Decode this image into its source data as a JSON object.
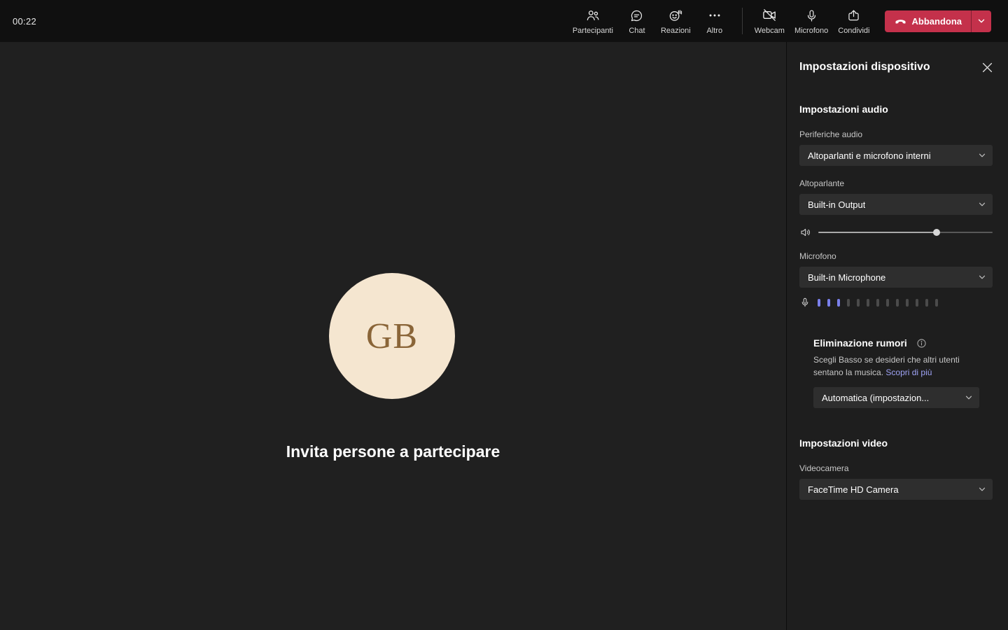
{
  "topbar": {
    "timer": "00:22",
    "buttons": {
      "participants": "Partecipanti",
      "chat": "Chat",
      "reactions": "Reazioni",
      "more": "Altro",
      "webcam": "Webcam",
      "microphone": "Microfono",
      "share": "Condividi",
      "leave": "Abbandona"
    }
  },
  "stage": {
    "avatar_initials": "GB",
    "invite_text": "Invita persone a partecipare"
  },
  "panel": {
    "title": "Impostazioni dispositivo",
    "audio": {
      "section_title": "Impostazioni audio",
      "devices_label": "Periferiche audio",
      "devices_value": "Altoparlanti e microfono interni",
      "speaker_label": "Altoparlante",
      "speaker_value": "Built-in Output",
      "volume_percent": 68,
      "mic_label": "Microfono",
      "mic_value": "Built-in Microphone",
      "mic_level_active": 3,
      "mic_level_total": 13
    },
    "noise": {
      "title": "Eliminazione rumori",
      "description": "Scegli Basso se desideri che altri utenti sentano la musica.",
      "link": "Scopri di più",
      "value": "Automatica (impostazion..."
    },
    "video": {
      "section_title": "Impostazioni video",
      "camera_label": "Videocamera",
      "camera_value": "FaceTime HD Camera"
    }
  },
  "colors": {
    "accent": "#7a80eb",
    "leave_red": "#c4314b",
    "link": "#9fa3f5",
    "avatar_bg": "#f5e6d0",
    "avatar_text": "#8a6538"
  }
}
